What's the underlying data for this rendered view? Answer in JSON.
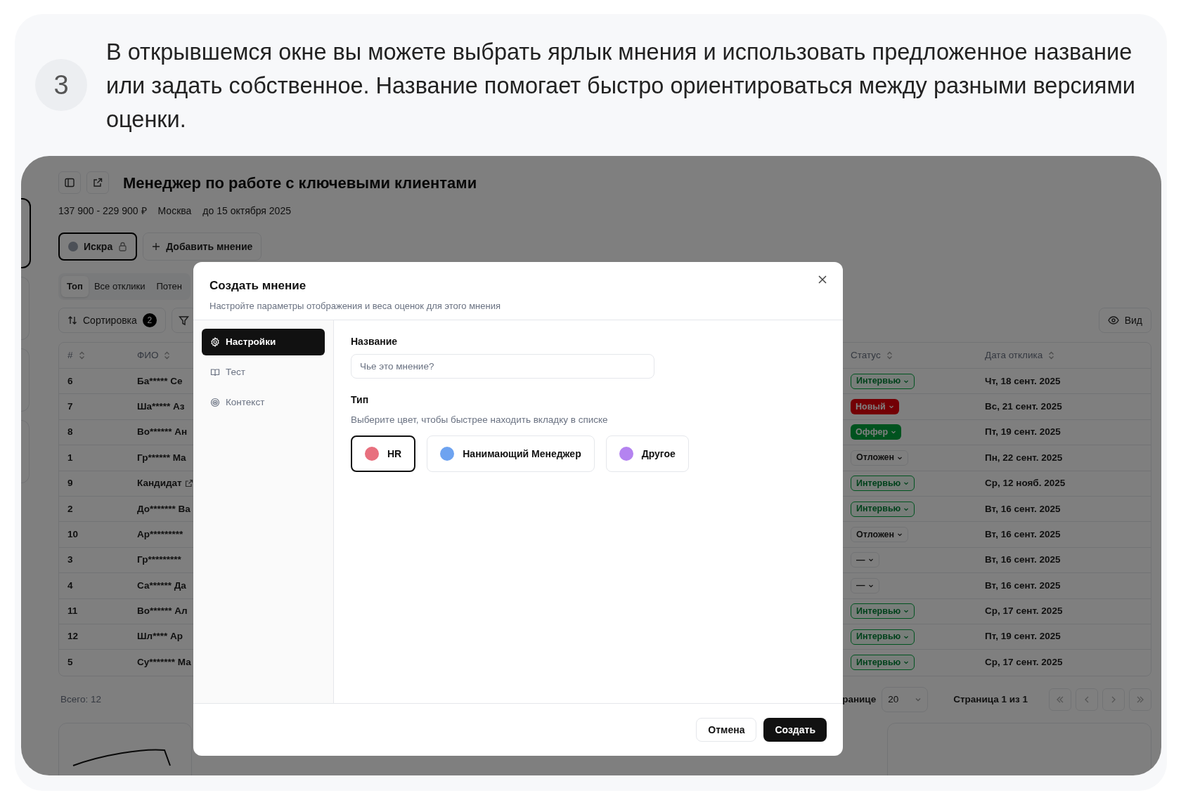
{
  "step": {
    "number": "3",
    "text": "В открывшемся окне вы можете выбрать ярлык мнения и использовать предложенное название или задать собственное. Название помогает быстро ориентироваться между разными версиями оценки."
  },
  "sidebar": [
    {
      "selected": true
    },
    {
      "selected": false
    },
    {
      "selected": false
    },
    {
      "selected": false
    }
  ],
  "app": {
    "title": "Менеджер по работе с ключевыми клиентами",
    "meta": [
      "137 900 - 229 900 ₽",
      "Москва",
      "до 15 октября 2025"
    ],
    "opinions": [
      {
        "label": "Искра",
        "selected": true,
        "locked": true
      }
    ],
    "add_opinion": "Добавить мнение",
    "tabs": [
      {
        "label": "Топ",
        "selected": true
      },
      {
        "label": "Все отклики",
        "selected": false
      },
      {
        "label": "Потен",
        "selected": false
      }
    ],
    "sort": {
      "label": "Сортировка",
      "count": "2"
    },
    "view_button": "Вид",
    "table": {
      "columns": [
        "#",
        "ФИО",
        "Статус",
        "Дата отклика"
      ],
      "rows": [
        {
          "number": "6",
          "name": "Ба***** Се",
          "status": {
            "label": "Интервью",
            "kind": "interview"
          },
          "date": "Чт, 18 сент. 2025"
        },
        {
          "number": "7",
          "name": "Ша***** Аз",
          "status": {
            "label": "Новый",
            "kind": "new"
          },
          "date": "Вс, 21 сент. 2025"
        },
        {
          "number": "8",
          "name": "Во****** Ан",
          "status": {
            "label": "Оффер",
            "kind": "offer"
          },
          "date": "Пт, 19 сент. 2025"
        },
        {
          "number": "1",
          "name": "Гр****** Ма",
          "status": {
            "label": "Отложен",
            "kind": "postponed"
          },
          "date": "Пн, 22 сент. 2025"
        },
        {
          "number": "9",
          "name": "Кандидат",
          "edit_icon": true,
          "status": {
            "label": "Интервью",
            "kind": "interview"
          },
          "date": "Ср, 12 нояб. 2025"
        },
        {
          "number": "2",
          "name": "До******* Ва",
          "status": {
            "label": "Интервью",
            "kind": "interview"
          },
          "date": "Вт, 16 сент. 2025"
        },
        {
          "number": "10",
          "name": "Ар*********",
          "status": {
            "label": "Отложен",
            "kind": "postponed"
          },
          "date": "Вт, 16 сент. 2025"
        },
        {
          "number": "3",
          "name": "Гр*********",
          "status": {
            "label": "—",
            "kind": "none"
          },
          "date": "Вт, 16 сент. 2025"
        },
        {
          "number": "4",
          "name": "Са****** Да",
          "status": {
            "label": "—",
            "kind": "none"
          },
          "date": "Вт, 16 сент. 2025"
        },
        {
          "number": "11",
          "name": "Во****** Ал",
          "status": {
            "label": "Интервью",
            "kind": "interview"
          },
          "date": "Ср, 17 сент. 2025"
        },
        {
          "number": "12",
          "name": "Шл**** Ар",
          "status": {
            "label": "Интервью",
            "kind": "interview"
          },
          "date": "Пт, 19 сент. 2025"
        },
        {
          "number": "5",
          "name": "Су******* Ма",
          "status": {
            "label": "Интервью",
            "kind": "interview"
          },
          "date": "Ср, 17 сент. 2025"
        }
      ]
    },
    "footer": {
      "total": "Всего: 12",
      "per_page_label": "ранице",
      "per_page": "20",
      "page": "Страница 1 из 1"
    }
  },
  "modal": {
    "title": "Создать мнение",
    "subtitle": "Настройте параметры отображения и веса оценок для этого мнения",
    "nav": [
      {
        "label": "Настройки",
        "selected": true,
        "kind": "gear"
      },
      {
        "label": "Тест",
        "selected": false,
        "kind": "book"
      },
      {
        "label": "Контекст",
        "selected": false,
        "kind": "target"
      }
    ],
    "name_label": "Название",
    "name_placeholder": "Чье это мнение?",
    "type_label": "Тип",
    "type_hint": "Выберите цвет, чтобы быстрее находить вкладку в списке",
    "types": [
      {
        "label": "HR",
        "color": "#e8707e",
        "selected": true
      },
      {
        "label": "Нанимающий Менеджер",
        "color": "#6ea3f0",
        "selected": false
      },
      {
        "label": "Другое",
        "color": "#b483f0",
        "selected": false
      }
    ],
    "cancel": "Отмена",
    "submit": "Создать"
  }
}
